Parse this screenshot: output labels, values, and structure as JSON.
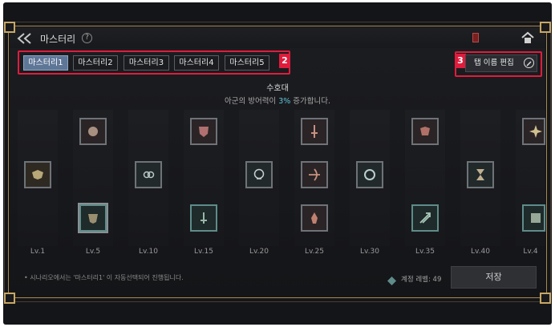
{
  "header": {
    "title": "마스터리",
    "help": "?"
  },
  "tabs": [
    {
      "label": "마스터리1",
      "active": true
    },
    {
      "label": "마스터리2",
      "active": false
    },
    {
      "label": "마스터리3",
      "active": false
    },
    {
      "label": "마스터리4",
      "active": false
    },
    {
      "label": "마스터리5",
      "active": false
    }
  ],
  "badges": {
    "tabs": "2",
    "edit": "3"
  },
  "edit_button": {
    "label": "탭 이름 편집"
  },
  "description": {
    "title": "수호대",
    "text_before": "아군의 방어력이 ",
    "percent": "3%",
    "text_after": " 증가합니다."
  },
  "levels": [
    "Lv.1",
    "Lv.5",
    "Lv.10",
    "Lv.15",
    "Lv.20",
    "Lv.25",
    "Lv.30",
    "Lv.35",
    "Lv.40",
    "Lv.4"
  ],
  "footer": {
    "note": "• 시나리오에서는 '마스터리1' 이 자동선택되어 진행됩니다.",
    "account_level": "계정 레벨: 49",
    "save_label": "저장"
  },
  "colors": {
    "accent_red": "#e01c3c",
    "active_tab": "#5f7797",
    "frame_gold": "#a8894e",
    "percent_cyan": "#5ec6d8"
  }
}
